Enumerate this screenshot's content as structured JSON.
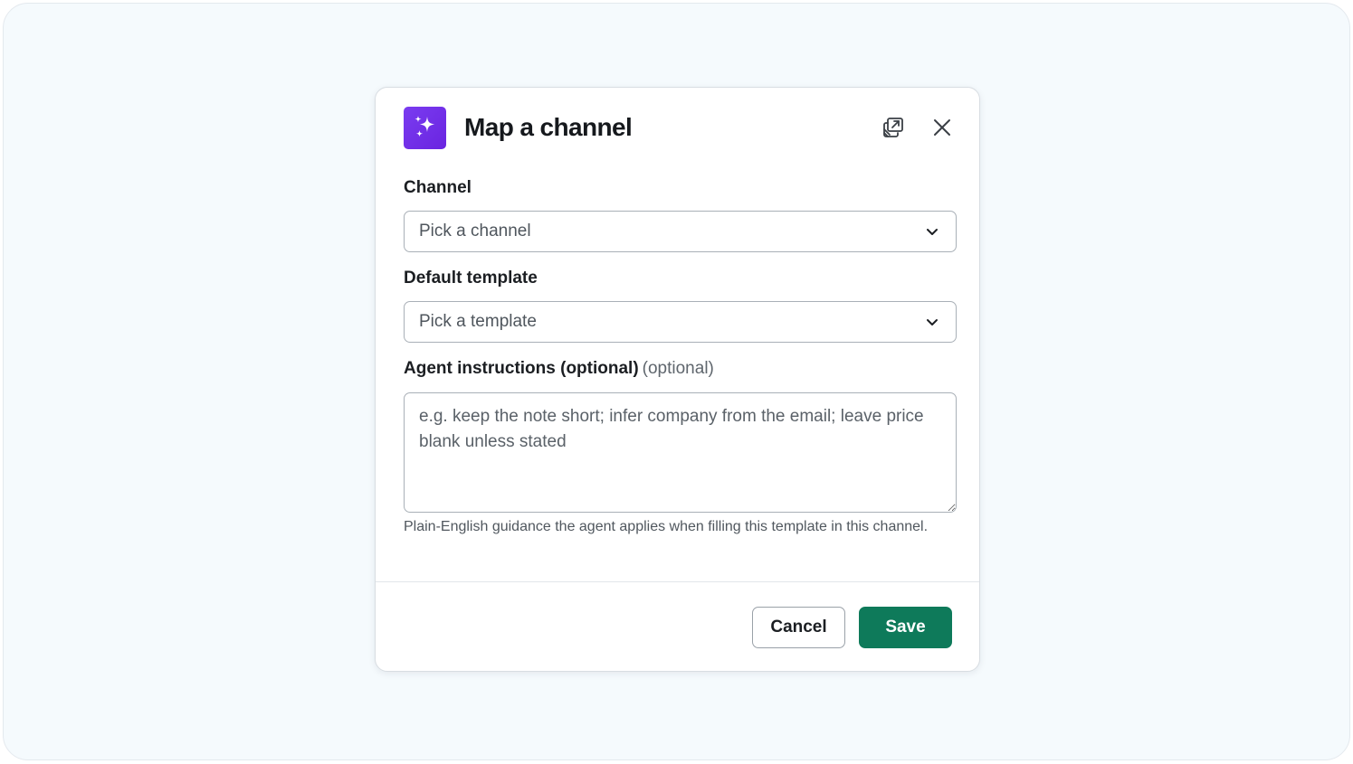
{
  "colors": {
    "backdrop": "#f5fafd",
    "accent_purple": "#7a3cf0",
    "primary_green": "#0e7a5a"
  },
  "modal": {
    "title": "Map a channel",
    "logo_icon": "sparkles-icon",
    "header_icons": [
      "external-windows-icon",
      "close-icon"
    ]
  },
  "fields": {
    "channel": {
      "label": "Channel",
      "value": "Pick a channel",
      "icon": "chevron-down-icon"
    },
    "template": {
      "label": "Default template",
      "value": "Pick a template",
      "icon": "chevron-down-icon"
    },
    "instructions": {
      "label": "Agent instructions (optional)",
      "optional_suffix": "(optional)",
      "placeholder": "e.g. keep the note short; infer company from the email; leave price blank unless stated",
      "value": "",
      "help": "Plain-English guidance the agent applies when filling this template in this channel."
    }
  },
  "footer": {
    "cancel_label": "Cancel",
    "save_label": "Save"
  }
}
